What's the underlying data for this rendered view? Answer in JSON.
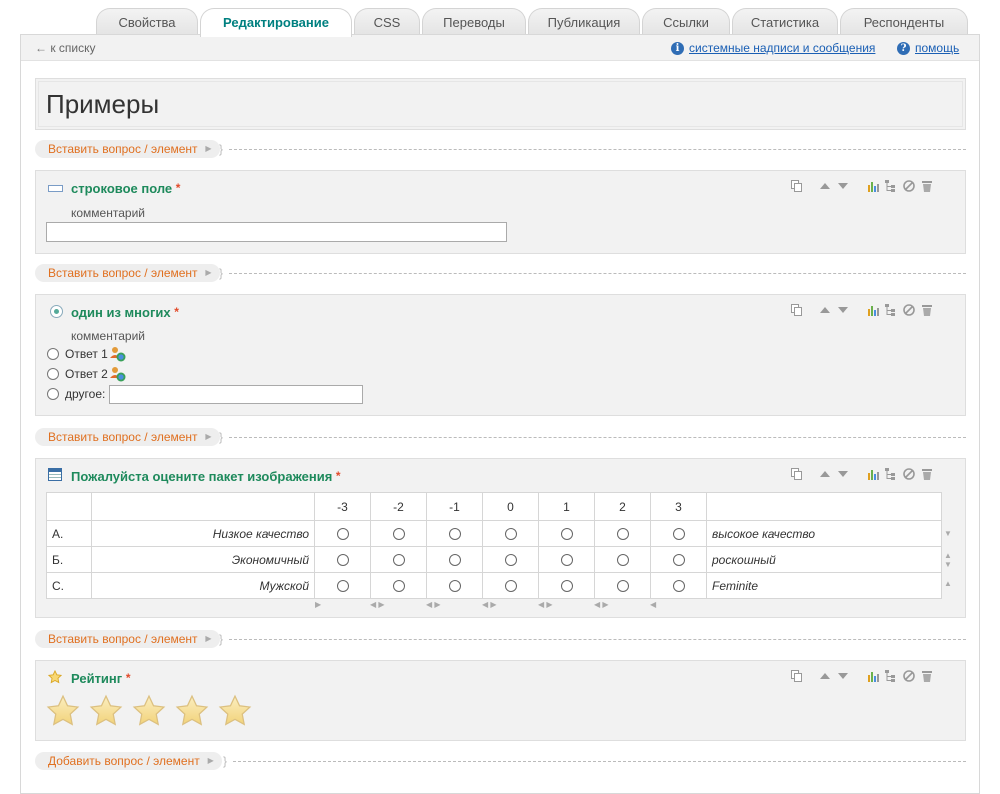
{
  "tabs": [
    "Свойства",
    "Редактирование",
    "CSS",
    "Переводы",
    "Публикация",
    "Ссылки",
    "Статистика",
    "Респонденты"
  ],
  "active_tab": "Редактирование",
  "toolbar": {
    "back_label": "к списку",
    "system_labels_link": "системные надписи и сообщения",
    "help_link": "помощь"
  },
  "page_title": "Примеры",
  "insert_label": "Вставить вопрос / элемент",
  "add_label": "Добавить вопрос / элемент",
  "questions": {
    "text": {
      "title": "строковое поле",
      "comment": "комментарий",
      "value": ""
    },
    "single": {
      "title": "один из многих",
      "comment": "комментарий",
      "options": [
        "Ответ 1",
        "Ответ 2"
      ],
      "other_label": "другое:",
      "other_value": ""
    },
    "matrix": {
      "title": "Пожалуйста оцените пакет изображения",
      "scale": [
        "-3",
        "-2",
        "-1",
        "0",
        "1",
        "2",
        "3"
      ],
      "rows": [
        {
          "key": "A.",
          "left": "Низкое качество",
          "right": "высокое качество"
        },
        {
          "key": "Б.",
          "left": "Экономичный",
          "right": "роскошный"
        },
        {
          "key": "С.",
          "left": "Мужской",
          "right": "Feminite"
        }
      ]
    },
    "rating": {
      "title": "Рейтинг",
      "stars": 5,
      "value": 0
    }
  },
  "colors": {
    "accent_tab": "#008080",
    "question_title": "#1e8a5c",
    "insert_text": "#e07020",
    "required": "#e24a2a",
    "link": "#1a5fb4"
  }
}
